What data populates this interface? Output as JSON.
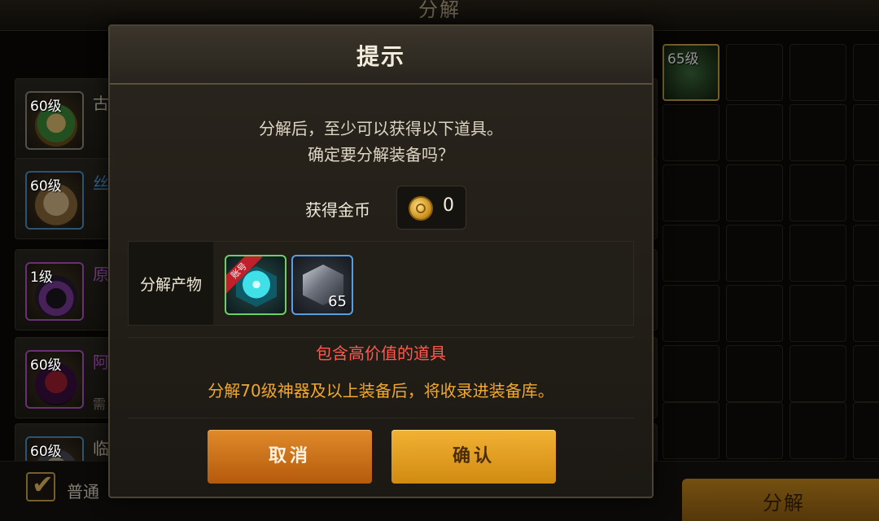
{
  "screen": {
    "title": "分解",
    "list_items": [
      {
        "level": "60级",
        "name": "古",
        "sub": "",
        "art": "helmet",
        "border": "gray",
        "name_color": "white"
      },
      {
        "level": "60级",
        "name": "丝",
        "sub": "",
        "art": "armor",
        "border": "blue",
        "name_color": "blue"
      },
      {
        "level": "1级",
        "name": "原",
        "sub": "",
        "art": "ring",
        "border": "purple",
        "name_color": "purple"
      },
      {
        "level": "60级",
        "name": "阿",
        "sub": "需",
        "art": "cloth",
        "border": "purple",
        "name_color": "purple"
      },
      {
        "level": "60级",
        "name": "临",
        "sub": "",
        "art": "armor2",
        "border": "blue",
        "name_color": "white"
      }
    ],
    "grid_first_item_level": "65级",
    "filter_checkbox": {
      "label": "普通",
      "checked": true
    },
    "decompose_button": "分解"
  },
  "dialog": {
    "title": "提示",
    "message_line1": "分解后，至少可以获得以下道具。",
    "message_line2": "确定要分解装备吗？",
    "gold_label": "获得金币",
    "gold_icon": "coin-icon",
    "gold_value": "0",
    "products_label": "分解产物",
    "products": [
      {
        "icon": "crystal-icon",
        "rarity": "green",
        "tag": "账号",
        "count": ""
      },
      {
        "icon": "cube-icon",
        "rarity": "blue",
        "tag": "",
        "count": "65"
      }
    ],
    "warning": "包含高价值的道具",
    "info": "分解70级神器及以上装备后，将收录进装备库。",
    "cancel_label": "取消",
    "confirm_label": "确认"
  }
}
